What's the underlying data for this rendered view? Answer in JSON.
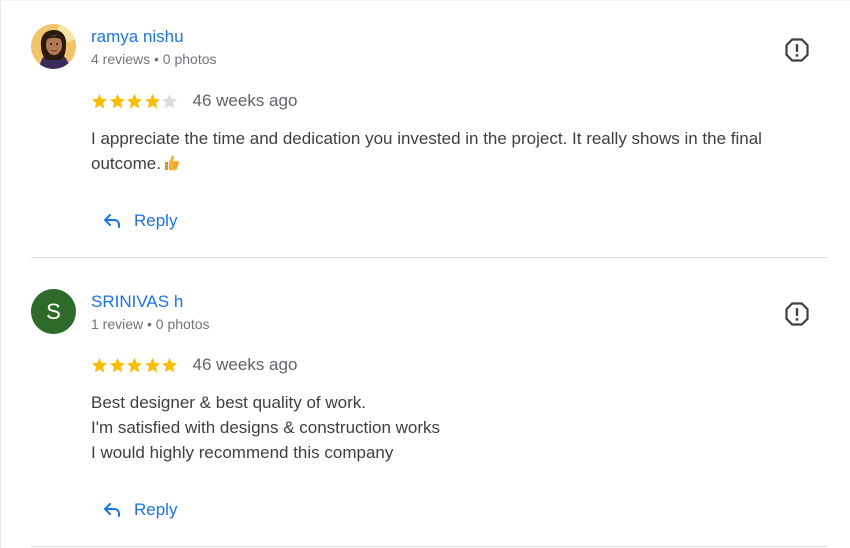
{
  "reviews": [
    {
      "author": "ramya nishu",
      "meta": "4 reviews • 0 photos",
      "rating": 4,
      "max_rating": 5,
      "time_ago": "46 weeks ago",
      "text_lines": [
        "I appreciate the time and dedication you invested in the project. It really shows in the final",
        "outcome."
      ],
      "reply_label": "Reply"
    },
    {
      "author": "SRINIVAS h",
      "avatar_initial": "S",
      "meta": "1 review • 0 photos",
      "rating": 5,
      "max_rating": 5,
      "time_ago": "46 weeks ago",
      "text_lines": [
        "Best designer & best quality of work.",
        "I'm satisfied with designs & construction works",
        "I would highly recommend this company"
      ],
      "reply_label": "Reply"
    }
  ],
  "icons": {
    "flag": "report-flag-icon",
    "reply": "reply-arrow-icon",
    "star": "star-icon",
    "thumbs_up": "thumbs-up-emoji-icon"
  },
  "colors": {
    "link_blue": "#1a73e8",
    "star_gold": "#fbbc04",
    "star_empty": "#dadce0",
    "avatar_green": "#2e6a2a",
    "divider": "#dadce0"
  }
}
